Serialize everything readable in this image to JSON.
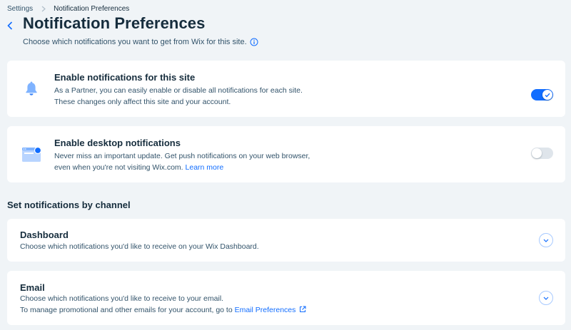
{
  "breadcrumb": {
    "items": [
      "Settings",
      "Notification Preferences"
    ]
  },
  "header": {
    "back_icon": "chevron-left-icon",
    "title": "Notification Preferences",
    "subtitle": "Choose which notifications you want to get from Wix for this site.",
    "info_icon": "info-icon"
  },
  "cards": {
    "site_notifications": {
      "icon": "bell-icon",
      "title": "Enable notifications for this site",
      "desc_lines": [
        "As a Partner, you can easily enable or disable all notifications for each site.",
        "These changes only affect this site and your account."
      ],
      "toggle_on": true
    },
    "desktop_notifications": {
      "icon": "browser-notification-icon",
      "title": "Enable desktop notifications",
      "desc_lines": [
        "Never miss an important update. Get push notifications on your web browser,",
        "even when you're not visiting Wix.com."
      ],
      "link_text": "Learn more",
      "toggle_on": false
    }
  },
  "channels": {
    "heading": "Set notifications by channel",
    "dashboard": {
      "title": "Dashboard",
      "desc": "Choose which notifications you'd like to receive on your Wix Dashboard."
    },
    "email": {
      "title": "Email",
      "desc_line1": "Choose which notifications you'd like to receive to your email.",
      "desc_line2": "To manage promotional and other emails for your account, go to",
      "link_text": "Email Preferences",
      "link_icon": "external-link-icon"
    }
  },
  "colors": {
    "accent": "#116dff",
    "background": "#f0f4f7",
    "card": "#ffffff",
    "text_primary": "#162d3d",
    "text_secondary": "#32536a"
  }
}
